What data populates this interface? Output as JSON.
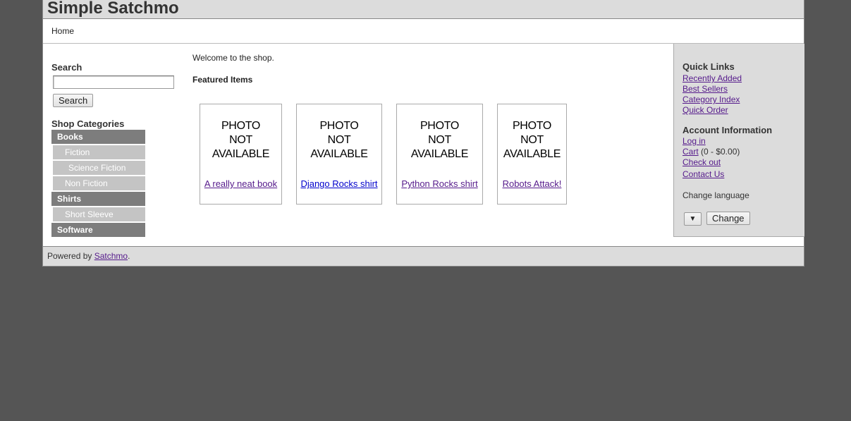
{
  "site": {
    "title": "Simple Satchmo"
  },
  "nav": {
    "home": "Home"
  },
  "search": {
    "label": "Search",
    "value": "",
    "placeholder": "",
    "button": "Search"
  },
  "categories": {
    "title": "Shop Categories",
    "items": [
      {
        "label": "Books",
        "level": 0
      },
      {
        "label": "Fiction",
        "level": 1
      },
      {
        "label": "Science Fiction",
        "level": 2
      },
      {
        "label": "Non Fiction",
        "level": 1
      },
      {
        "label": "Shirts",
        "level": 0
      },
      {
        "label": "Short Sleeve",
        "level": 1
      },
      {
        "label": "Software",
        "level": 0
      }
    ]
  },
  "main": {
    "welcome": "Welcome to the shop.",
    "featured_title": "Featured Items",
    "products": [
      {
        "photo_lines": [
          "PHOTO",
          "NOT",
          "AVAILABLE"
        ],
        "name": "A really neat book"
      },
      {
        "photo_lines": [
          "PHOTO",
          "NOT",
          "AVAILABLE"
        ],
        "name": "Django Rocks shirt"
      },
      {
        "photo_lines": [
          "PHOTO",
          "NOT",
          "AVAILABLE"
        ],
        "name": "Python Rocks shirt"
      },
      {
        "photo_lines": [
          "PHOTO",
          "NOT",
          "AVAILABLE"
        ],
        "name": "Robots Attack!"
      }
    ]
  },
  "sidebar": {
    "quick_links_title": "Quick Links",
    "quick_links": [
      "Recently Added",
      "Best Sellers",
      "Category Index",
      "Quick Order"
    ],
    "account_title": "Account Information",
    "login": "Log in",
    "cart": "Cart",
    "cart_summary": "(0 - $0.00)",
    "checkout": "Check out",
    "contact": "Contact Us",
    "language_label": "Change language",
    "language_select_value": "",
    "change_button": "Change"
  },
  "footer": {
    "prefix": "Powered by",
    "link": "Satchmo",
    "suffix": "."
  },
  "colors": {
    "page_bg": "#555555",
    "panel_bg": "#dcdcdc",
    "category_bg": "#7d7d7d",
    "subcategory_bg": "#c4c4c4",
    "link_visited": "#551a8b",
    "link": "#0000cc"
  }
}
